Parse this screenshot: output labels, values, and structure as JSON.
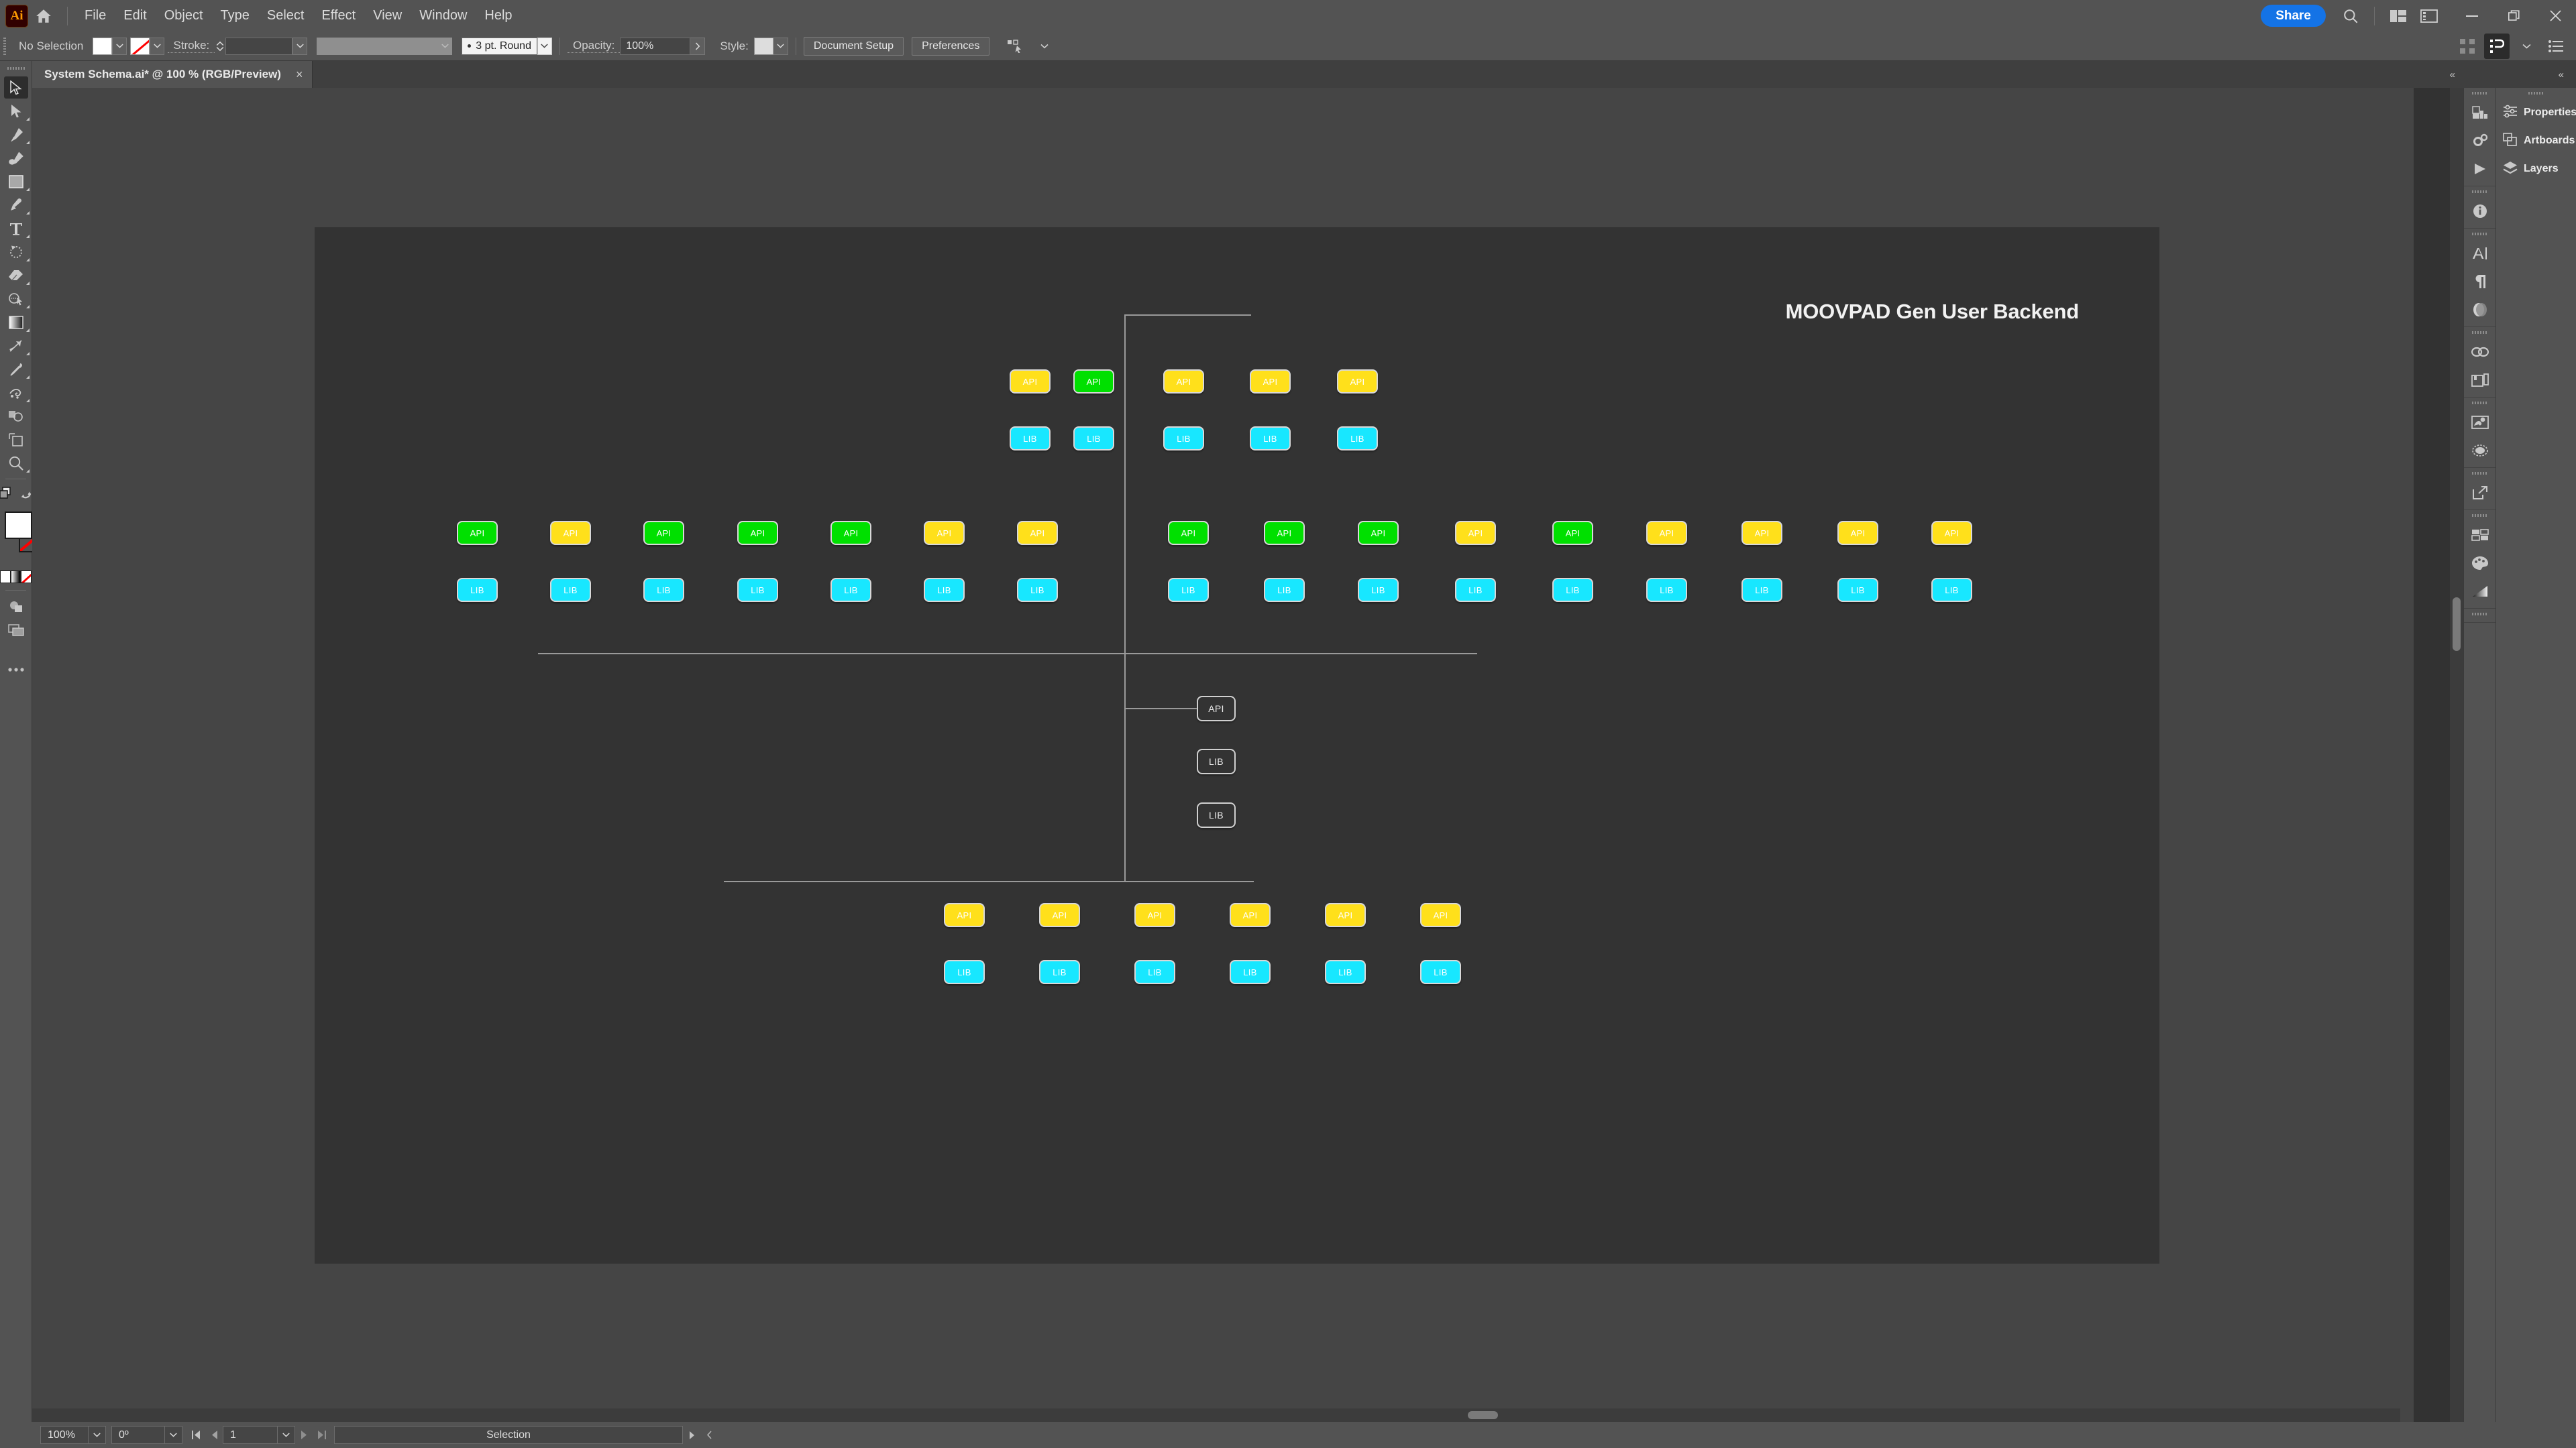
{
  "app": {
    "logo_text": "Ai",
    "home_icon": "home-icon",
    "share_label": "Share",
    "search_icon": "search-icon",
    "arrange_icon": "arrange-documents-icon",
    "workspace_icon": "workspace-switcher-icon",
    "minimize_icon": "minimize-icon",
    "maximize_icon": "restore-icon",
    "close_icon": "close-icon"
  },
  "menu": {
    "items": [
      {
        "label": "File"
      },
      {
        "label": "Edit"
      },
      {
        "label": "Object"
      },
      {
        "label": "Type"
      },
      {
        "label": "Select"
      },
      {
        "label": "Effect"
      },
      {
        "label": "View"
      },
      {
        "label": "Window"
      },
      {
        "label": "Help"
      }
    ]
  },
  "control_bar": {
    "selection_status": "No Selection",
    "fill_swatch_color": "#FFFFFF",
    "stroke_swatch": "none",
    "stroke_label": "Stroke:",
    "stroke_weight": "",
    "stroke_profile": "",
    "brush_definition": "3 pt. Round",
    "opacity_label": "Opacity:",
    "opacity_value": "100%",
    "style_label": "Style:",
    "style_swatch_color": "#DDDDDD",
    "document_setup_label": "Document Setup",
    "preferences_label": "Preferences",
    "align_icon": "align-objects-icon",
    "snap_grid_icon": "snap-to-grid-icon",
    "select_similar_icon": "select-similar-objects-icon",
    "chevron_icon": "chevron-down-icon",
    "list_icon": "document-list-icon"
  },
  "document_tab": {
    "title": "System Schema.ai* @ 100 % (RGB/Preview)",
    "close_icon": "close-icon",
    "expand_icon": "expand-panel-icon"
  },
  "toolbar": {
    "tools": [
      {
        "name": "selection-tool",
        "selected": true,
        "has_flyout": false
      },
      {
        "name": "direct-selection-tool",
        "selected": false,
        "has_flyout": true
      },
      {
        "name": "pen-tool",
        "selected": false,
        "has_flyout": true
      },
      {
        "name": "curvature-tool",
        "selected": false,
        "has_flyout": false
      },
      {
        "name": "rectangle-tool",
        "selected": false,
        "has_flyout": true
      },
      {
        "name": "paintbrush-tool",
        "selected": false,
        "has_flyout": true
      },
      {
        "name": "type-tool",
        "selected": false,
        "has_flyout": true
      },
      {
        "name": "rotate-tool",
        "selected": false,
        "has_flyout": true
      },
      {
        "name": "eraser-tool",
        "selected": false,
        "has_flyout": true
      },
      {
        "name": "shape-builder-tool",
        "selected": false,
        "has_flyout": true
      },
      {
        "name": "gradient-tool",
        "selected": false,
        "has_flyout": true
      },
      {
        "name": "width-tool",
        "selected": false,
        "has_flyout": true
      },
      {
        "name": "eyedropper-tool",
        "selected": false,
        "has_flyout": true
      },
      {
        "name": "symbol-sprayer-tool",
        "selected": false,
        "has_flyout": true
      },
      {
        "name": "artboard-overlap-tool",
        "selected": false,
        "has_flyout": false
      },
      {
        "name": "artboard-tool",
        "selected": false,
        "has_flyout": false
      },
      {
        "name": "zoom-tool",
        "selected": false,
        "has_flyout": true
      }
    ],
    "fill_color": "#FFFFFF",
    "stroke_color": "none",
    "swap_icon": "swap-fill-stroke-icon",
    "draw_modes_icon": "drawing-modes-icon",
    "screen_mode_icon": "screen-mode-icon",
    "more_icon": "edit-toolbar-icon"
  },
  "right_dock": {
    "icon_groups": [
      {
        "icons": [
          "graph-panel-icon",
          "actions-panel-icon",
          "play-icon"
        ]
      },
      {
        "icons": [
          "info-panel-icon"
        ]
      },
      {
        "icons": [
          "character-panel-icon",
          "paragraph-panel-icon",
          "transparency-panel-icon"
        ]
      },
      {
        "icons": [
          "links-panel-icon",
          "artboards-panel-icon"
        ]
      },
      {
        "icons": [
          "image-trace-panel-icon",
          "appearance-panel-icon"
        ]
      },
      {
        "icons": [
          "export-panel-icon"
        ]
      },
      {
        "icons": [
          "swatches-panel-icon",
          "color-panel-icon",
          "gradient-panel-icon"
        ]
      },
      {
        "icons": [
          "pathfinder-panel-icon"
        ]
      }
    ],
    "panels": [
      {
        "label": "Properties",
        "icon": "properties-icon"
      },
      {
        "label": "Artboards",
        "icon": "artboards-icon"
      },
      {
        "label": "Layers",
        "icon": "layers-icon"
      }
    ]
  },
  "status_bar": {
    "zoom_level": "100%",
    "rotation": "0º",
    "artboard_number": "1",
    "tool_status": "Selection",
    "first_icon": "first-artboard-icon",
    "prev_icon": "previous-artboard-icon",
    "next_icon": "next-artboard-icon",
    "last_icon": "last-artboard-icon",
    "menu_arrow_icon": "status-menu-icon",
    "collapse_icon": "collapse-icon"
  },
  "artwork": {
    "title": "MOOVPAD Gen User Backend",
    "colors": {
      "background": "#333333",
      "green": "#00E000",
      "yellow": "#FFE01B",
      "cyan": "#18E7FF",
      "line": "#9A9A9A",
      "node_border": "#D8D8D8"
    },
    "labels": {
      "api": "API",
      "lib": "LIB"
    },
    "groups": [
      {
        "name": "top-cluster",
        "api_row": [
          {
            "label": "API",
            "color": "yellow"
          },
          {
            "label": "API",
            "color": "green"
          },
          {
            "label": "API",
            "color": "yellow"
          },
          {
            "label": "API",
            "color": "yellow"
          },
          {
            "label": "API",
            "color": "yellow"
          }
        ],
        "lib_row": [
          {
            "label": "LIB",
            "color": "cyan"
          },
          {
            "label": "LIB",
            "color": "cyan"
          },
          {
            "label": "LIB",
            "color": "cyan"
          },
          {
            "label": "LIB",
            "color": "cyan"
          },
          {
            "label": "LIB",
            "color": "cyan"
          }
        ]
      },
      {
        "name": "middle-left-cluster",
        "api_row": [
          {
            "label": "API",
            "color": "green"
          },
          {
            "label": "API",
            "color": "yellow"
          },
          {
            "label": "API",
            "color": "green"
          },
          {
            "label": "API",
            "color": "green"
          },
          {
            "label": "API",
            "color": "green"
          },
          {
            "label": "API",
            "color": "yellow"
          },
          {
            "label": "API",
            "color": "yellow"
          }
        ],
        "lib_row": [
          {
            "label": "LIB",
            "color": "cyan"
          },
          {
            "label": "LIB",
            "color": "cyan"
          },
          {
            "label": "LIB",
            "color": "cyan"
          },
          {
            "label": "LIB",
            "color": "cyan"
          },
          {
            "label": "LIB",
            "color": "cyan"
          },
          {
            "label": "LIB",
            "color": "cyan"
          },
          {
            "label": "LIB",
            "color": "cyan"
          }
        ]
      },
      {
        "name": "middle-right-cluster",
        "api_row": [
          {
            "label": "API",
            "color": "green"
          },
          {
            "label": "API",
            "color": "green"
          },
          {
            "label": "API",
            "color": "green"
          },
          {
            "label": "API",
            "color": "yellow"
          },
          {
            "label": "API",
            "color": "green"
          },
          {
            "label": "API",
            "color": "yellow"
          },
          {
            "label": "API",
            "color": "yellow"
          },
          {
            "label": "API",
            "color": "yellow"
          },
          {
            "label": "API",
            "color": "yellow"
          }
        ],
        "lib_row": [
          {
            "label": "LIB",
            "color": "cyan"
          },
          {
            "label": "LIB",
            "color": "cyan"
          },
          {
            "label": "LIB",
            "color": "cyan"
          },
          {
            "label": "LIB",
            "color": "cyan"
          },
          {
            "label": "LIB",
            "color": "cyan"
          },
          {
            "label": "LIB",
            "color": "cyan"
          },
          {
            "label": "LIB",
            "color": "cyan"
          },
          {
            "label": "LIB",
            "color": "cyan"
          },
          {
            "label": "LIB",
            "color": "cyan"
          }
        ]
      },
      {
        "name": "center-outline-cluster",
        "nodes": [
          {
            "label": "API",
            "color": "hollow"
          },
          {
            "label": "LIB",
            "color": "hollow"
          },
          {
            "label": "LIB",
            "color": "hollow"
          }
        ]
      },
      {
        "name": "bottom-cluster",
        "api_row": [
          {
            "label": "API",
            "color": "yellow"
          },
          {
            "label": "API",
            "color": "yellow"
          },
          {
            "label": "API",
            "color": "yellow"
          },
          {
            "label": "API",
            "color": "yellow"
          },
          {
            "label": "API",
            "color": "yellow"
          },
          {
            "label": "API",
            "color": "yellow"
          }
        ],
        "lib_row": [
          {
            "label": "LIB",
            "color": "cyan"
          },
          {
            "label": "LIB",
            "color": "cyan"
          },
          {
            "label": "LIB",
            "color": "cyan"
          },
          {
            "label": "LIB",
            "color": "cyan"
          },
          {
            "label": "LIB",
            "color": "cyan"
          },
          {
            "label": "LIB",
            "color": "cyan"
          }
        ]
      }
    ]
  }
}
